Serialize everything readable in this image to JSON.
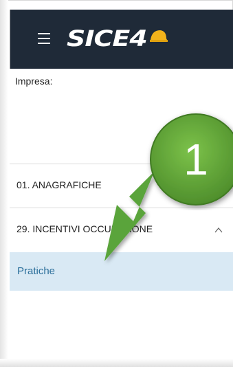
{
  "header": {
    "logo_text": "SICE4",
    "hamburger_icon": "hamburger-menu-icon",
    "background_color": "#1f2a38"
  },
  "company": {
    "label": "Impresa:"
  },
  "menu": {
    "items": [
      {
        "label": "01. ANAGRAFICHE"
      },
      {
        "label": "29. INCENTIVI OCCUPAZIONE",
        "expanded": true,
        "chevron_icon": "chevron-up-icon"
      }
    ],
    "subitems": [
      {
        "label": "Pratiche",
        "selected": true
      }
    ]
  },
  "annotation": {
    "number": "1",
    "color": "#5a9e3a"
  }
}
